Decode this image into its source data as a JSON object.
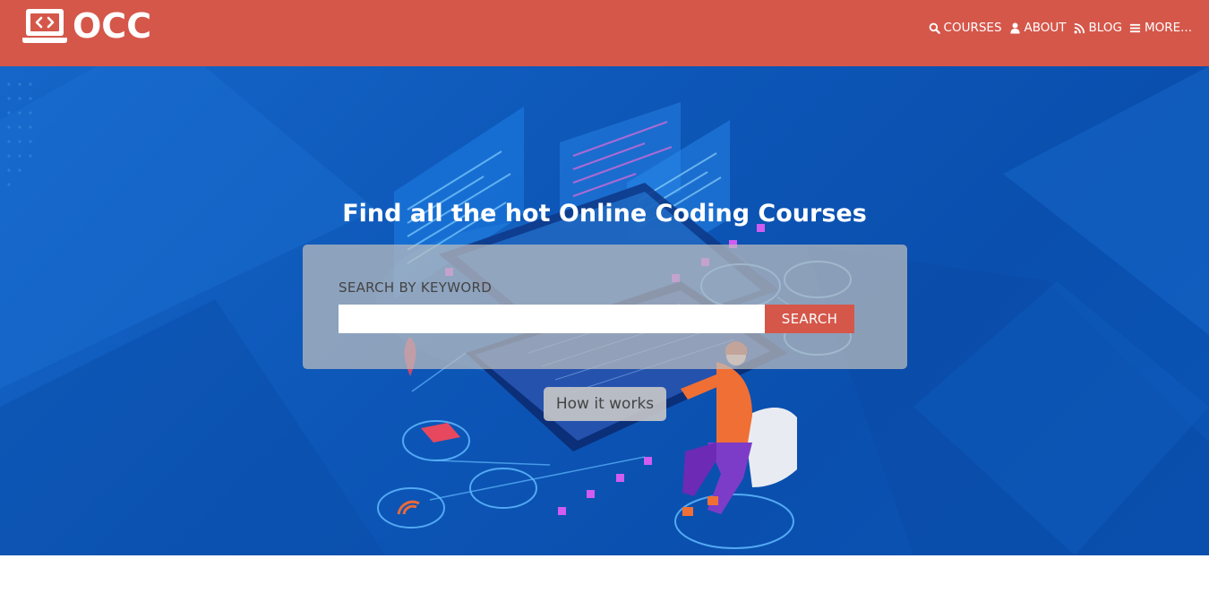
{
  "brand": {
    "name": "OCC",
    "logo_icon": "laptop-code-icon"
  },
  "nav": {
    "items": [
      {
        "label": "COURSES",
        "icon": "search-icon"
      },
      {
        "label": "ABOUT",
        "icon": "user-icon"
      },
      {
        "label": "BLOG",
        "icon": "rss-icon"
      },
      {
        "label": "MORE...",
        "icon": "bars-icon"
      }
    ]
  },
  "hero": {
    "title": "Find all the hot Online Coding Courses",
    "illustration": "developer-at-laptop-illustration",
    "search": {
      "label": "SEARCH BY KEYWORD",
      "input_value": "",
      "button_label": "SEARCH"
    },
    "how_it_works_label": "How it works"
  },
  "colors": {
    "brand_red": "#d5574a",
    "hero_blue": "#0d57b8",
    "text_white": "#ffffff",
    "search_panel": "#bebebe"
  }
}
